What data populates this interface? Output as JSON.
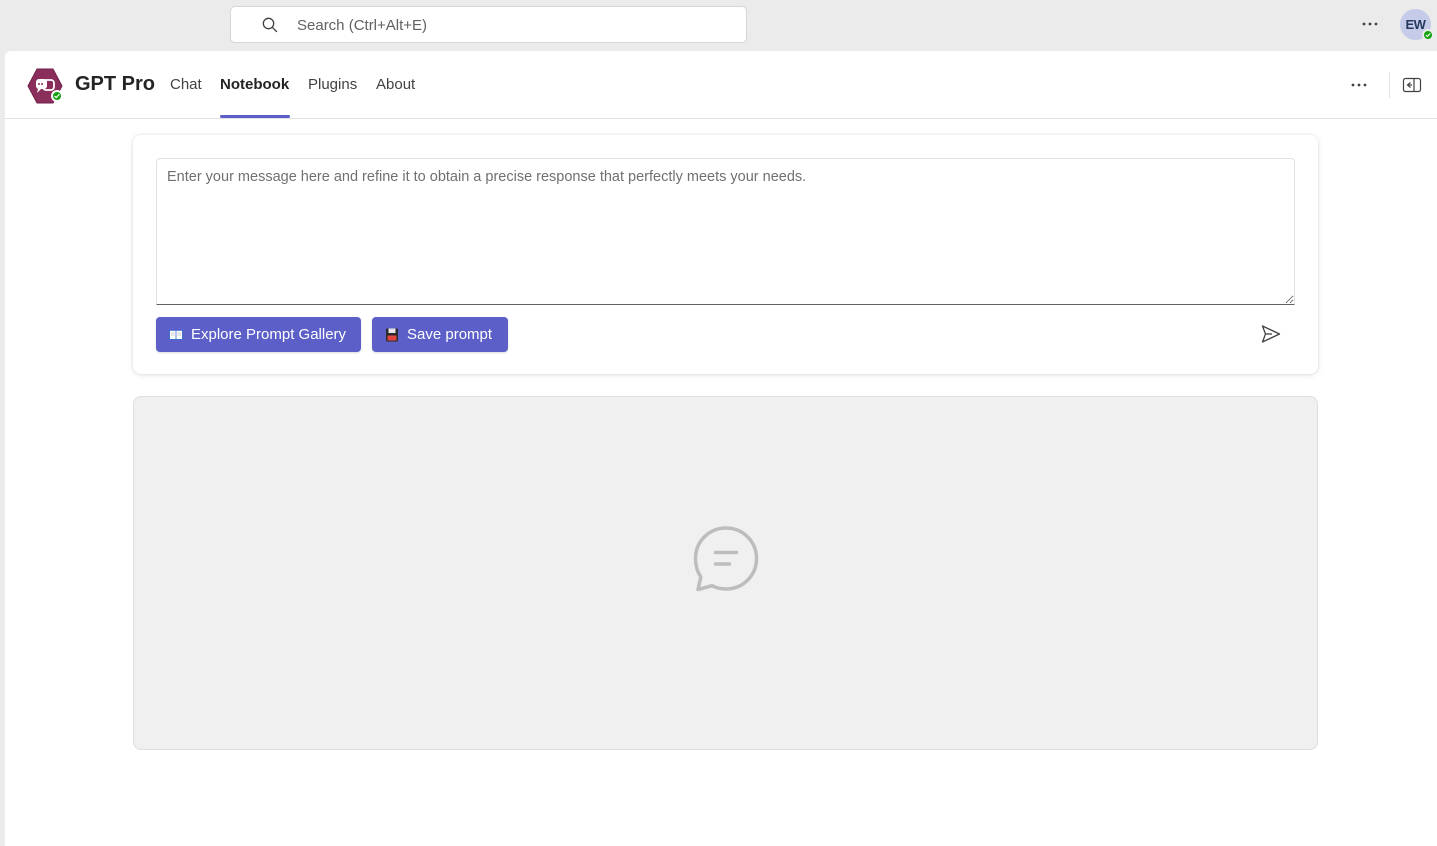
{
  "topbar": {
    "search_placeholder": "Search (Ctrl+Alt+E)",
    "more_icon": "more-horizontal-icon",
    "avatar_initials": "EW",
    "presence_status": "available"
  },
  "app": {
    "title": "GPT Pro",
    "logo_icon": "gpt-pro-logo",
    "tabs": [
      {
        "label": "Chat",
        "active": false
      },
      {
        "label": "Notebook",
        "active": true
      },
      {
        "label": "Plugins",
        "active": false
      },
      {
        "label": "About",
        "active": false
      }
    ],
    "header_more_icon": "more-horizontal-icon",
    "panel_icon": "open-side-panel-icon"
  },
  "composer": {
    "placeholder": "Enter your message here and refine it to obtain a precise response that perfectly meets your needs.",
    "value": "",
    "explore_button": "Explore Prompt Gallery",
    "explore_icon": "open-book-icon",
    "save_button": "Save prompt",
    "save_icon": "floppy-disk-icon",
    "send_icon": "send-icon"
  },
  "response": {
    "empty_icon": "chat-bubble-icon"
  },
  "colors": {
    "accent": "#5b5fc7",
    "presence": "#13a10e",
    "app_logo": "#8a2f5c",
    "chrome_background": "#ebebeb",
    "response_background": "#f0f0f0"
  }
}
